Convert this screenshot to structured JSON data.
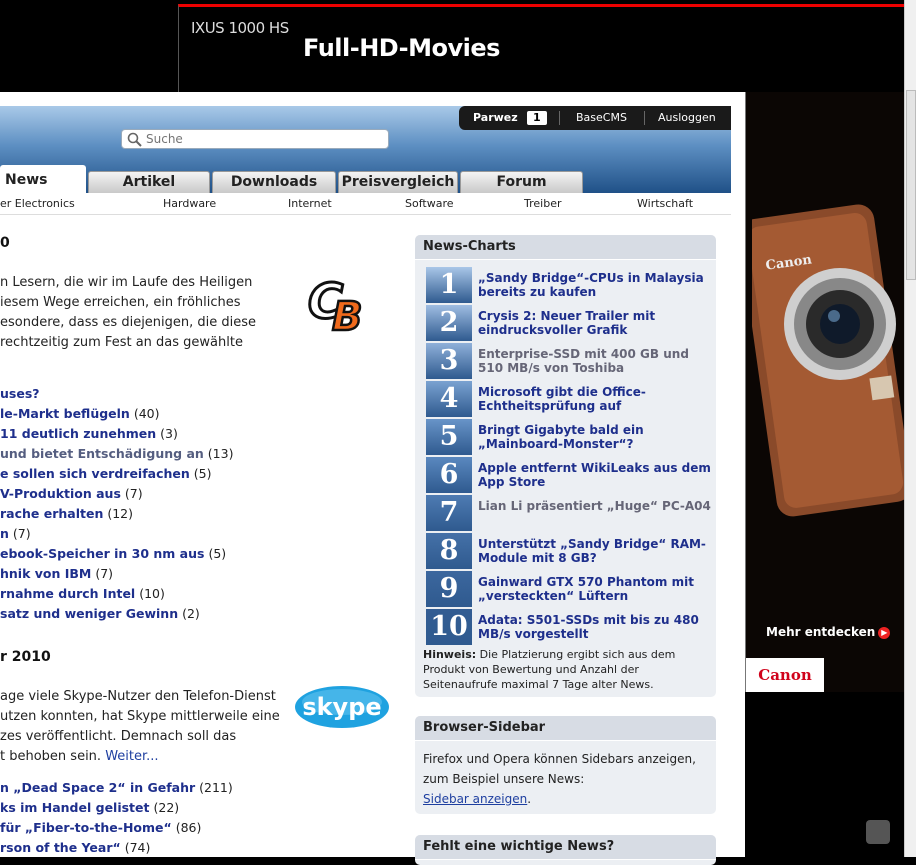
{
  "top_ad": {
    "brand": "IXUS 1000 HS",
    "tagline": "Full-HD-Movies"
  },
  "right_ad": {
    "more": "Mehr entdecken",
    "logo": "Canon"
  },
  "userbar": {
    "user": "Parwez",
    "count": "1",
    "link1": "BaseCMS",
    "link2": "Ausloggen"
  },
  "search": {
    "placeholder": "Suche"
  },
  "tabs": [
    "News",
    "Artikel",
    "Downloads",
    "Preisvergleich",
    "Forum"
  ],
  "subnav": [
    "er Electronics",
    "Hardware",
    "Internet",
    "Software",
    "Treiber",
    "Wirtschaft"
  ],
  "article1": {
    "title": "0",
    "lines": [
      "n Lesern, die wir im Laufe des Heiligen",
      "iesem Wege erreichen, ein fröhliches",
      "esondere, dass es diejenigen, die diese",
      " rechtzeitig zum Fest an das gewählte"
    ],
    "links": [
      {
        "t": "uses?",
        "c": ""
      },
      {
        "t": "le-Markt beflügeln",
        "c": "(40)"
      },
      {
        "t": "11 deutlich zunehmen",
        "c": "(3)"
      },
      {
        "t": "und bietet Entschädigung an",
        "c": "(13)"
      },
      {
        "t": "e sollen sich verdreifachen",
        "c": "(5)"
      },
      {
        "t": "V-Produktion aus",
        "c": "(7)"
      },
      {
        "t": "rache erhalten",
        "c": "(12)"
      },
      {
        "t": "n",
        "c": "(7)"
      },
      {
        "t": "ebook-Speicher in 30 nm aus",
        "c": "(5)"
      },
      {
        "t": "hnik von IBM",
        "c": "(7)"
      },
      {
        "t": "rnahme durch Intel",
        "c": "(10)"
      },
      {
        "t": "satz und weniger Gewinn",
        "c": "(2)"
      }
    ]
  },
  "article2": {
    "title": "r 2010",
    "lines": [
      "age viele Skype-Nutzer den Telefon-Dienst",
      "utzen konnten, hat Skype mittlerweile eine",
      "zes veröffentlicht. Demnach soll das",
      "t behoben sein."
    ],
    "more": "Weiter...",
    "links": [
      {
        "t": "n „Dead Space 2“ in Gefahr",
        "c": "(211)"
      },
      {
        "t": "ks im Handel gelistet",
        "c": "(22)"
      },
      {
        "t": "für „Fiber-to-the-Home“",
        "c": "(86)"
      },
      {
        "t": "rson of the Year“",
        "c": "(74)"
      }
    ]
  },
  "news_charts": {
    "title": "News-Charts",
    "items": [
      {
        "rank": "1",
        "text": "„Sandy Bridge“-CPUs in Malaysia bereits zu kaufen",
        "visited": false
      },
      {
        "rank": "2",
        "text": "Crysis 2: Neuer Trailer mit eindrucksvoller Grafik",
        "visited": false
      },
      {
        "rank": "3",
        "text": "Enterprise-SSD mit 400 GB und 510 MB/s von Toshiba",
        "visited": true
      },
      {
        "rank": "4",
        "text": "Microsoft gibt die Office-Echtheitsprüfung auf",
        "visited": false
      },
      {
        "rank": "5",
        "text": "Bringt Gigabyte bald ein „Mainboard-Monster“?",
        "visited": false
      },
      {
        "rank": "6",
        "text": "Apple entfernt WikiLeaks aus dem App Store",
        "visited": false
      },
      {
        "rank": "7",
        "text": "Lian Li präsentiert „Huge“ PC-A04",
        "visited": true
      },
      {
        "rank": "8",
        "text": "Unterstützt „Sandy Bridge“ RAM-Module mit 8 GB?",
        "visited": false
      },
      {
        "rank": "9",
        "text": "Gainward GTX 570 Phantom mit „versteckten“ Lüftern",
        "visited": false
      },
      {
        "rank": "10",
        "text": "Adata: S501-SSDs mit bis zu 480 MB/s vorgestellt",
        "visited": false
      }
    ],
    "hint_label": "Hinweis:",
    "hint_text": " Die Platzierung ergibt sich aus dem Produkt von Bewertung und Anzahl der Seitenaufrufe maximal 7 Tage alter News."
  },
  "browser_sidebar": {
    "title": "Browser-Sidebar",
    "text": "Firefox und Opera können Sidebars anzeigen, zum Beispiel unsere News:",
    "link": "Sidebar anzeigen",
    "dot": "."
  },
  "missing_news": {
    "title": "Fehlt eine wichtige News?"
  }
}
